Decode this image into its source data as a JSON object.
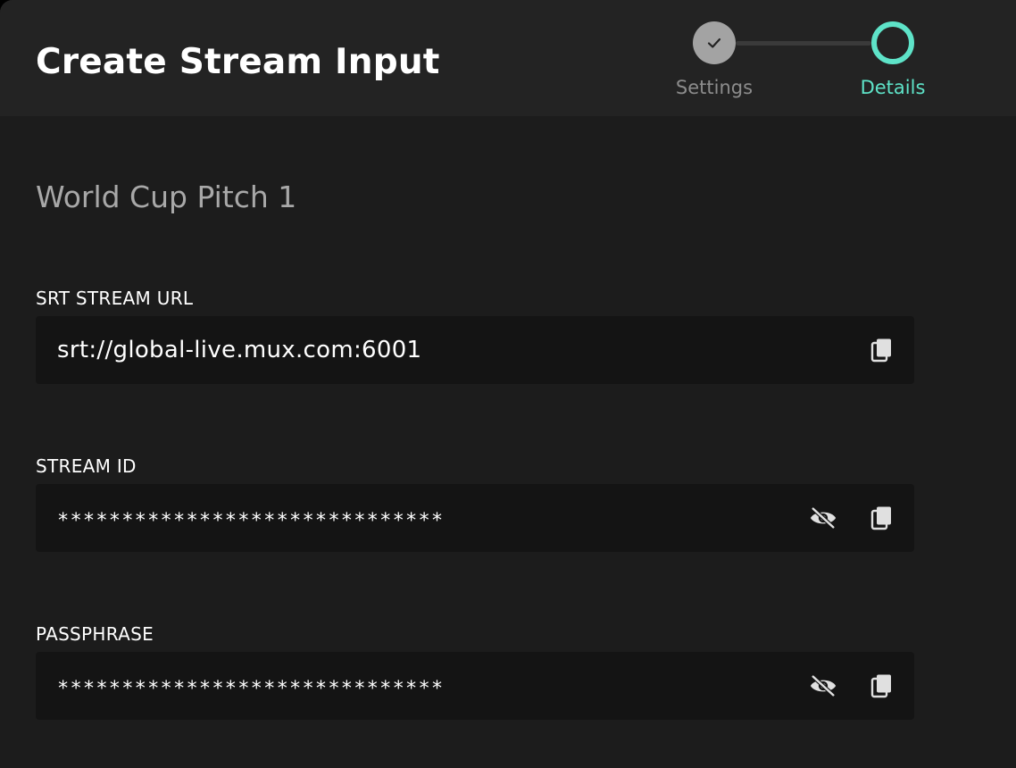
{
  "header": {
    "title": "Create Stream Input"
  },
  "stepper": {
    "steps": [
      {
        "label": "Settings",
        "state": "completed",
        "icon": "check-icon"
      },
      {
        "label": "Details",
        "state": "active"
      }
    ],
    "active_color": "#5ee3c8",
    "completed_color": "#a3a3a3"
  },
  "stream": {
    "name": "World Cup Pitch 1"
  },
  "fields": {
    "srt_url": {
      "label": "SRT STREAM URL",
      "value": "srt://global-live.mux.com:6001",
      "icons": [
        "copy-icon"
      ]
    },
    "stream_id": {
      "label": "STREAM ID",
      "value": "******************************",
      "icons": [
        "eye-off-icon",
        "copy-icon"
      ]
    },
    "passphrase": {
      "label": "PASSPHRASE",
      "value": "******************************",
      "icons": [
        "eye-off-icon",
        "copy-icon"
      ]
    }
  }
}
